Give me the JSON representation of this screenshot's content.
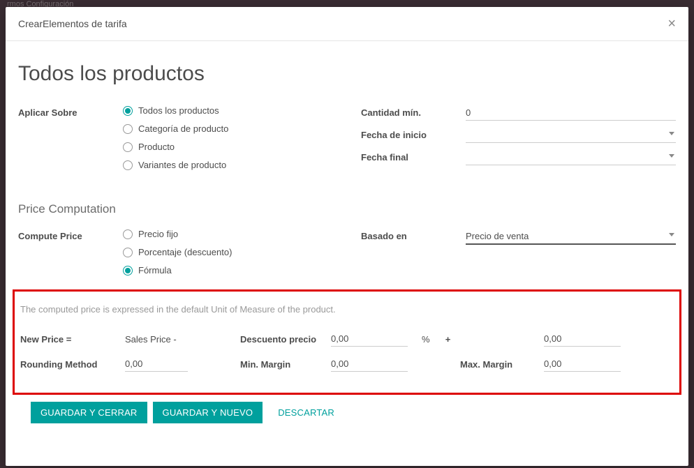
{
  "top_menu": "rmos    Configuración",
  "modal": {
    "header_title": "CrearElementos de tarifa",
    "main_title": "Todos los productos"
  },
  "apply_on": {
    "label": "Aplicar Sobre",
    "options": {
      "all": "Todos los productos",
      "category": "Categoría de producto",
      "product": "Producto",
      "variant": "Variantes de producto"
    }
  },
  "right_fields": {
    "min_qty_label": "Cantidad mín.",
    "min_qty_value": "0",
    "start_date_label": "Fecha de inicio",
    "start_date_value": "",
    "end_date_label": "Fecha final",
    "end_date_value": ""
  },
  "computation": {
    "section_title": "Price Computation",
    "compute_label": "Compute Price",
    "options": {
      "fixed": "Precio fijo",
      "percent": "Porcentaje (descuento)",
      "formula": "Fórmula"
    },
    "based_on_label": "Basado en",
    "based_on_value": "Precio de venta"
  },
  "formula": {
    "helper": "The computed price is expressed in the default Unit of Measure of the product.",
    "new_price_label": "New Price =",
    "base_label": "Sales Price -",
    "discount_label": "Descuento precio",
    "discount_value": "0,00",
    "percent_symbol": "%",
    "plus_symbol": "+",
    "extra_value": "0,00",
    "rounding_label": "Rounding Method",
    "rounding_value": "0,00",
    "min_margin_label": "Min. Margin",
    "min_margin_value": "0,00",
    "max_margin_label": "Max. Margin",
    "max_margin_value": "0,00"
  },
  "buttons": {
    "save_close": "GUARDAR Y CERRAR",
    "save_new": "GUARDAR Y NUEVO",
    "discard": "DESCARTAR"
  }
}
